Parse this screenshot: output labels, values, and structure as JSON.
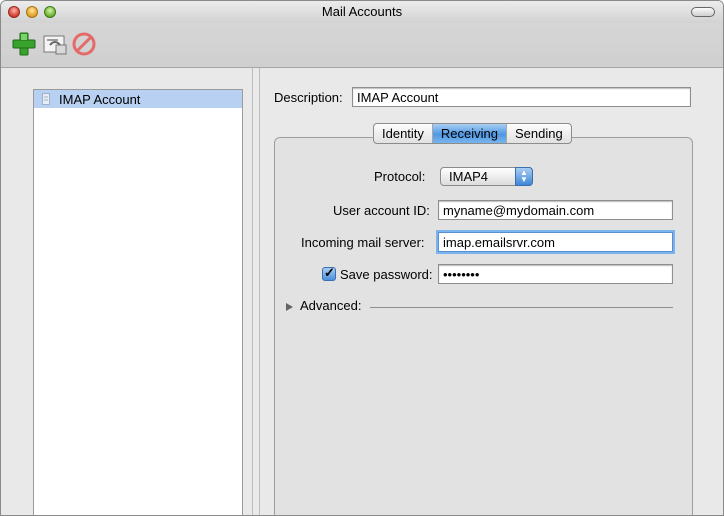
{
  "window": {
    "title": "Mail Accounts"
  },
  "toolbar": {
    "buttons": [
      {
        "icon": "plus-icon"
      },
      {
        "icon": "account-card-icon"
      },
      {
        "icon": "no-entry-icon"
      }
    ]
  },
  "sidebar": {
    "items": [
      {
        "label": "IMAP Account",
        "selected": true
      }
    ]
  },
  "form": {
    "description_label": "Description:",
    "description_value": "IMAP Account",
    "tabs": [
      {
        "label": "Identity",
        "active": false
      },
      {
        "label": "Receiving",
        "active": true
      },
      {
        "label": "Sending",
        "active": false
      }
    ],
    "protocol_label": "Protocol:",
    "protocol_value": "IMAP4",
    "user_id_label": "User account ID:",
    "user_id_value": "myname@mydomain.com",
    "server_label": "Incoming mail server:",
    "server_value": "imap.emailsrvr.com",
    "save_password_label": "Save password:",
    "save_password_checked": true,
    "password_value": "••••••••",
    "advanced_label": "Advanced:"
  },
  "colors": {
    "selection": "#b8d1f3",
    "accent": "#4f97e4"
  }
}
